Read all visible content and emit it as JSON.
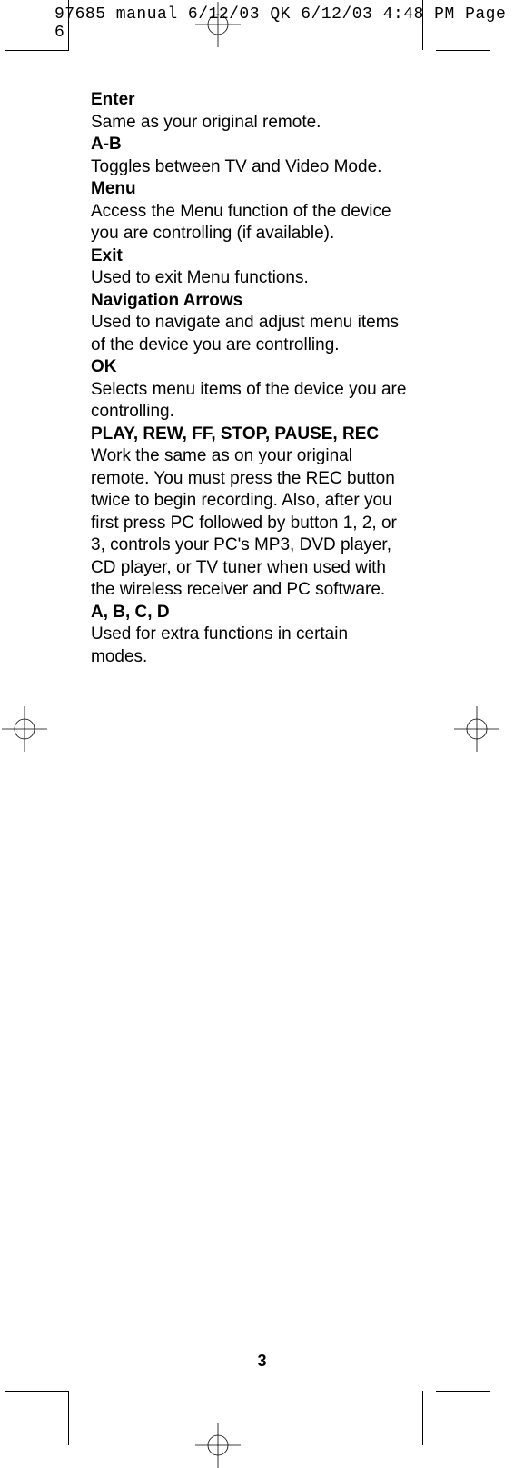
{
  "header": "97685 manual 6/12/03 QK  6/12/03  4:48 PM  Page 6",
  "entries": [
    {
      "title": "Enter",
      "body": "Same as your original remote."
    },
    {
      "title": "A-B",
      "body": "Toggles between TV and Video Mode."
    },
    {
      "title": "Menu",
      "body": "Access the Menu function of the device you are controlling (if available)."
    },
    {
      "title": "Exit",
      "body": "Used to exit Menu functions."
    },
    {
      "title": "Navigation Arrows",
      "body": "Used to navigate and adjust menu items of the device you are controlling."
    },
    {
      "title": "OK",
      "body": "Selects menu items of the device you are controlling."
    },
    {
      "title": "PLAY, REW, FF, STOP, PAUSE, REC",
      "body": "Work the same as on your original remote. You must press the REC button twice to begin recording. Also, after you first press PC followed by button 1, 2, or 3, controls your PC's MP3, DVD player, CD player, or TV tuner when used with the wireless receiver and PC software."
    },
    {
      "title": "A, B, C, D",
      "body": "Used for extra functions in certain modes."
    }
  ],
  "page_number": "3"
}
